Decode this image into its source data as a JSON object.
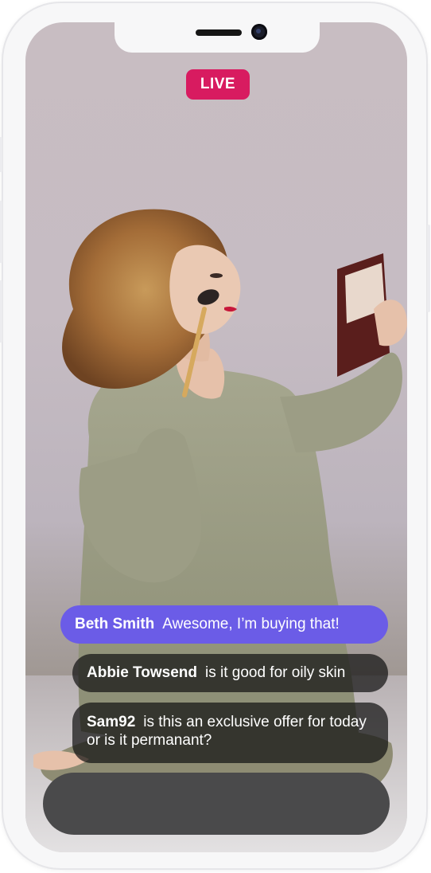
{
  "stream": {
    "live_label": "LIVE"
  },
  "comments": [
    {
      "user": "Beth Smith",
      "text": "Awesome, I’m buying that!",
      "highlighted": true
    },
    {
      "user": "Abbie Towsend",
      "text": "is it good for oily skin",
      "highlighted": false
    },
    {
      "user": "Sam92",
      "text": "is this an exclusive offer for today or is it permanant?",
      "highlighted": false
    }
  ],
  "colors": {
    "live_badge": "#d81b60",
    "highlight_comment": "#6b5ce7",
    "comment_bg": "#141414",
    "input_bar": "#4a4a4b"
  }
}
